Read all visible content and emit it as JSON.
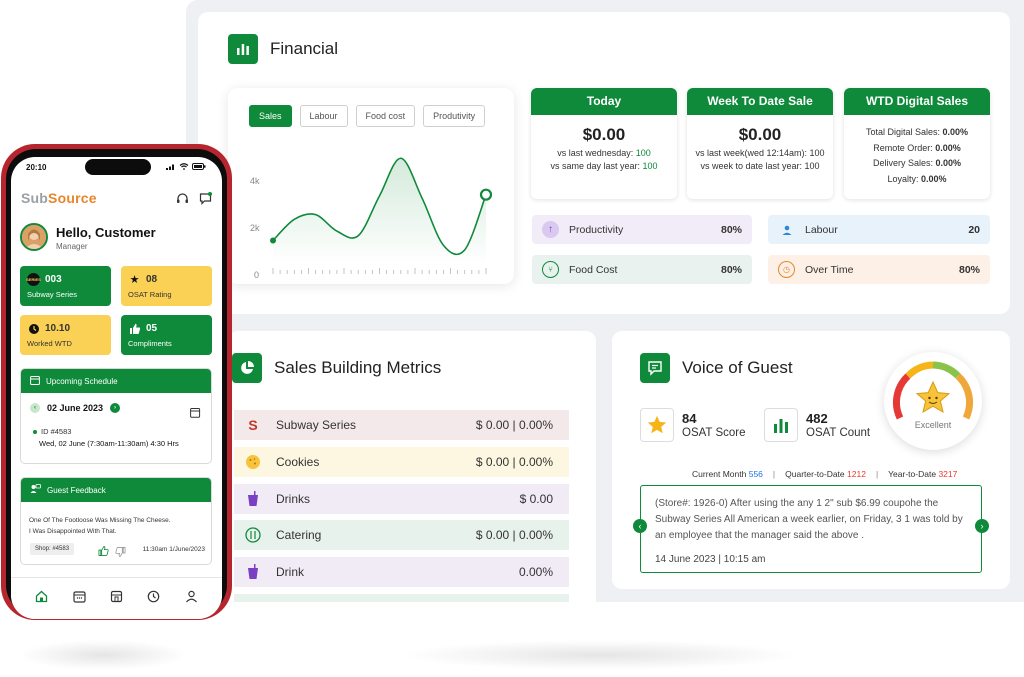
{
  "financial": {
    "title": "Financial",
    "chart_tabs": [
      "Sales",
      "Labour",
      "Food cost",
      "Produtivity"
    ],
    "y_ticks": [
      "4k",
      "2k",
      "0"
    ],
    "today": {
      "title": "Today",
      "value": "$0.00",
      "line1_label": "vs last wednesday:",
      "line1_value": "100",
      "line2_label": "vs same day last year:",
      "line2_value": "100"
    },
    "wtd_sale": {
      "title": "Week To Date Sale",
      "value": "$0.00",
      "line1_label": "vs last week(wed 12:14am):",
      "line1_value": "100",
      "line2_label": "vs week to date last year:",
      "line2_value": "100"
    },
    "wtd_digital": {
      "title": "WTD Digital Sales",
      "rows": [
        {
          "label": "Total Digital Sales:",
          "value": "0.00%"
        },
        {
          "label": "Remote Order:",
          "value": "0.00%"
        },
        {
          "label": "Delivery Sales:",
          "value": "0.00%"
        },
        {
          "label": "Loyalty:",
          "value": "0.00%"
        }
      ]
    },
    "metrics": {
      "productivity": {
        "label": "Productivity",
        "value": "80%"
      },
      "labour": {
        "label": "Labour",
        "value": "20"
      },
      "food_cost": {
        "label": "Food Cost",
        "value": "80%"
      },
      "over_time": {
        "label": "Over Time",
        "value": "80%"
      }
    }
  },
  "sales_building": {
    "title": "Sales Building Metrics",
    "rows": [
      {
        "label": "Subway Series",
        "value": "$ 0.00 | 0.00%"
      },
      {
        "label": "Cookies",
        "value": "$ 0.00 | 0.00%"
      },
      {
        "label": "Drinks",
        "value": "$ 0.00"
      },
      {
        "label": "Catering",
        "value": "$ 0.00 | 0.00%"
      },
      {
        "label": "Drink",
        "value": "0.00%"
      }
    ]
  },
  "voice_of_guest": {
    "title": "Voice of Guest",
    "osat_score": {
      "value": "84",
      "label": "OSAT Score"
    },
    "osat_count": {
      "value": "482",
      "label": "OSAT Count"
    },
    "gauge_label": "Excellent",
    "counts": {
      "current_month_label": "Current Month",
      "current_month_value": "556",
      "qtd_label": "Quarter-to-Date",
      "qtd_value": "1212",
      "ytd_label": "Year-to-Date",
      "ytd_value": "3217"
    },
    "review_text": "(Store#: 1926-0) After using the any 1 2\" sub $6.99 coupohe the Subway Series All American a week earlier, on Friday, 3 1 was told by an employee that the manager said the above .",
    "review_date": "14 June 2023  |  10:15 am"
  },
  "phone": {
    "time": "20:10",
    "logo_part1": "Sub",
    "logo_part2": "Source",
    "greeting": "Hello, Customer",
    "role": "Manager",
    "tiles": [
      {
        "value": "003",
        "label": "Subway Series"
      },
      {
        "value": "08",
        "label": "OSAT Rating"
      },
      {
        "value": "10.10",
        "label": "Worked WTD"
      },
      {
        "value": "05",
        "label": "Compliments"
      }
    ],
    "series_badge": "SERIES",
    "schedule": {
      "title": "Upcoming Schedule",
      "date": "02 June 2023",
      "id": "ID #4583",
      "time": "Wed, 02 June (7:30am-11:30am) 4:30 Hrs"
    },
    "feedback": {
      "title": "Guest Feedback",
      "line1": "One Of The Footloose Was Missing The Cheese.",
      "line2": "I Was Disappointed With That.",
      "shop": "Shop: #4583",
      "time": "11:30am 1/June/2023"
    }
  },
  "colors": {
    "brand_green": "#0e8a3a",
    "accent_orange": "#e8862a",
    "tile_yellow": "#fbd155",
    "phone_frame": "#b7252e"
  },
  "chart_data": {
    "type": "line",
    "x": [
      0,
      1,
      2,
      3,
      4,
      5,
      6,
      7,
      8,
      9,
      10
    ],
    "values": [
      1000,
      1900,
      2100,
      1400,
      1200,
      2900,
      4500,
      2800,
      800,
      600,
      2950
    ],
    "ylim": [
      0,
      4000
    ],
    "y_ticks": [
      "0",
      "2k",
      "4k"
    ],
    "grid": false
  }
}
